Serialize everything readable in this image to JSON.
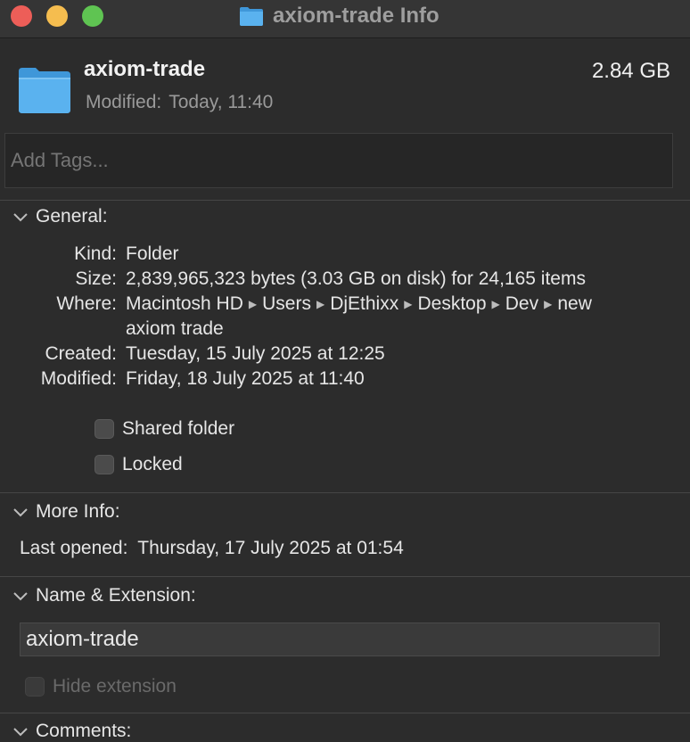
{
  "window": {
    "title": "axiom-trade Info"
  },
  "header": {
    "name": "axiom-trade",
    "modified_label": "Modified:",
    "modified_value": "Today, 11:40",
    "size": "2.84 GB"
  },
  "tags": {
    "placeholder": "Add Tags..."
  },
  "general": {
    "heading": "General:",
    "kind_label": "Kind:",
    "kind_value": "Folder",
    "size_label": "Size:",
    "size_value": "2,839,965,323 bytes (3.03 GB on disk) for 24,165 items",
    "where_label": "Where:",
    "where_path": [
      "Macintosh HD",
      "Users",
      "DjEthixx",
      "Desktop",
      "Dev",
      "new"
    ],
    "where_path_cont": "axiom trade",
    "created_label": "Created:",
    "created_value": "Tuesday, 15 July 2025 at 12:25",
    "modified_label": "Modified:",
    "modified_value": "Friday, 18 July 2025 at 11:40",
    "shared_folder_label": "Shared folder",
    "shared_folder_checked": false,
    "locked_label": "Locked",
    "locked_checked": false
  },
  "more_info": {
    "heading": "More Info:",
    "last_opened_label": "Last opened:",
    "last_opened_value": "Thursday, 17 July 2025 at 01:54"
  },
  "name_extension": {
    "heading": "Name & Extension:",
    "name_value": "axiom-trade",
    "hide_extension_label": "Hide extension",
    "hide_extension_checked": false
  },
  "comments": {
    "heading": "Comments:"
  },
  "icons": {
    "folder": "folder-icon",
    "chevron": "chevron-down-icon",
    "path_separator": "path-arrow-icon"
  },
  "colors": {
    "folder_blue": "#5ab2ef",
    "close": "#ed5e58",
    "minimize": "#f5bd4f",
    "zoom": "#5fc452",
    "background": "#2c2c2c"
  }
}
